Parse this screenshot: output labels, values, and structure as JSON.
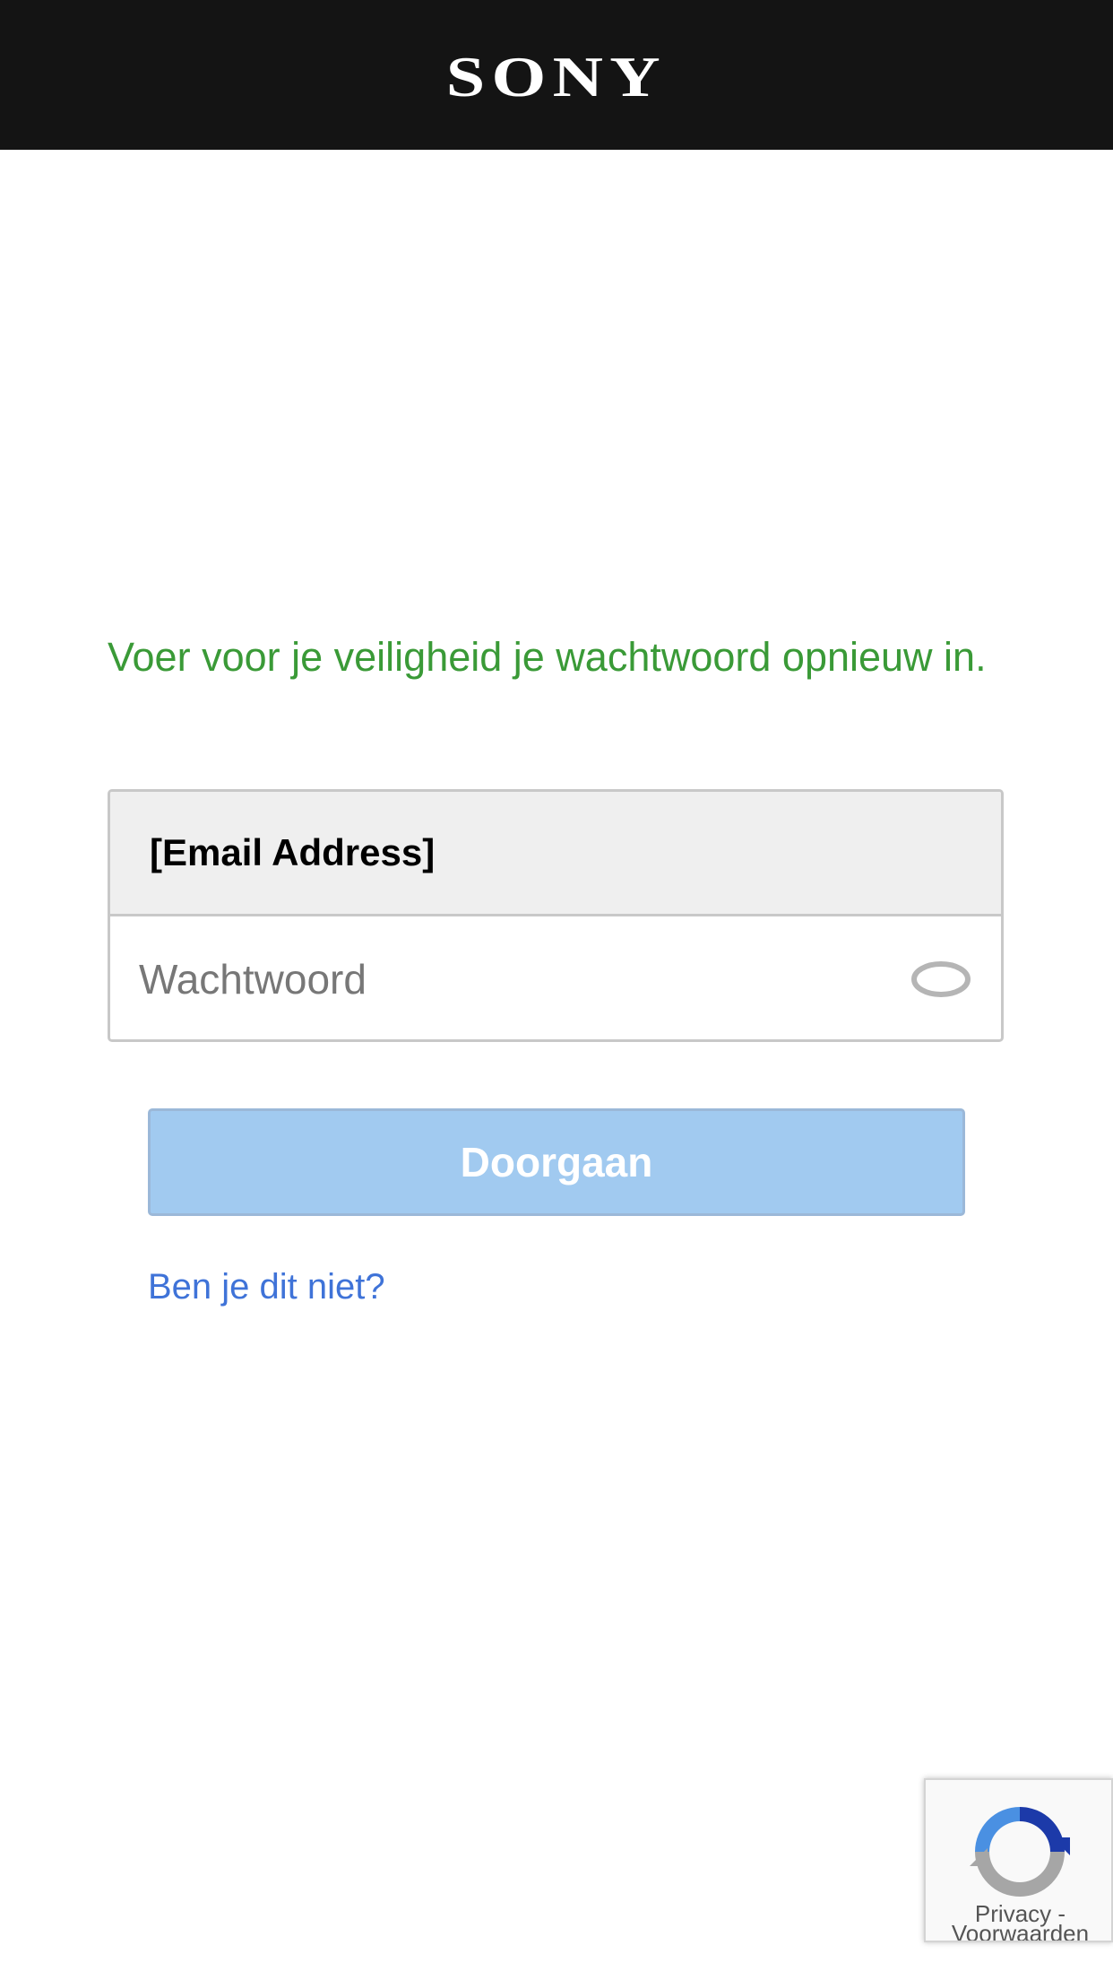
{
  "header": {
    "logo_text": "SONY",
    "background": "#141414"
  },
  "notice": {
    "text": "Voer voor je veiligheid je wachtwoord opnieuw in.",
    "color": "#3a9a37"
  },
  "form": {
    "email_value": "[Email Address]",
    "password_placeholder": "Wachtwoord",
    "password_value": "",
    "toggle_icon": "eye-icon"
  },
  "continue_button": {
    "label": "Doorgaan",
    "state": "disabled",
    "color": "#a1caf0"
  },
  "not_you_link": {
    "label": "Ben je dit niet?",
    "color": "#3f73d8"
  },
  "recaptcha": {
    "icon": "recaptcha-logo-icon",
    "privacy_label": "Privacy",
    "separator": "-",
    "terms_label": "Voorwaarden"
  }
}
